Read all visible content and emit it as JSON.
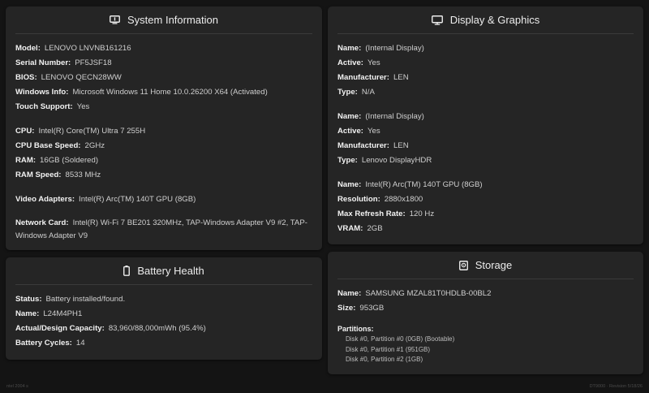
{
  "system": {
    "title": "System Information",
    "model_label": "Model:",
    "model": "LENOVO LNVNB161216",
    "serial_label": "Serial Number:",
    "serial": "PF5JSF18",
    "bios_label": "BIOS:",
    "bios": "LENOVO QECN28WW",
    "windows_label": "Windows Info:",
    "windows": "Microsoft Windows 11 Home 10.0.26200 X64 (Activated)",
    "touch_label": "Touch Support:",
    "touch": "Yes",
    "cpu_label": "CPU:",
    "cpu": "Intel(R) Core(TM) Ultra 7 255H",
    "cpu_speed_label": "CPU Base Speed:",
    "cpu_speed": "2GHz",
    "ram_label": "RAM:",
    "ram": "16GB (Soldered)",
    "ram_speed_label": "RAM Speed:",
    "ram_speed": "8533 MHz",
    "video_label": "Video Adapters:",
    "video": "Intel(R) Arc(TM) 140T GPU (8GB)",
    "network_label": "Network Card:",
    "network": "Intel(R) Wi-Fi 7 BE201 320MHz, TAP-Windows Adapter V9 #2, TAP-Windows Adapter V9"
  },
  "battery": {
    "title": "Battery Health",
    "status_label": "Status:",
    "status": "Battery installed/found.",
    "name_label": "Name:",
    "name": "L24M4PH1",
    "capacity_label": "Actual/Design Capacity:",
    "capacity": "83,960/88,000mWh (95.4%)",
    "cycles_label": "Battery Cycles:",
    "cycles": "14"
  },
  "display": {
    "title": "Display & Graphics",
    "d1": {
      "name_label": "Name:",
      "name": "(Internal Display)",
      "active_label": "Active:",
      "active": "Yes",
      "manufacturer_label": "Manufacturer:",
      "manufacturer": "LEN",
      "type_label": "Type:",
      "type": "N/A"
    },
    "d2": {
      "name_label": "Name:",
      "name": "(Internal Display)",
      "active_label": "Active:",
      "active": "Yes",
      "manufacturer_label": "Manufacturer:",
      "manufacturer": "LEN",
      "type_label": "Type:",
      "type": "Lenovo DisplayHDR"
    },
    "gpu": {
      "name_label": "Name:",
      "name": "Intel(R) Arc(TM) 140T GPU (8GB)",
      "resolution_label": "Resolution:",
      "resolution": "2880x1800",
      "refresh_label": "Max Refresh Rate:",
      "refresh": "120 Hz",
      "vram_label": "VRAM:",
      "vram": "2GB"
    }
  },
  "storage": {
    "title": "Storage",
    "name_label": "Name:",
    "name": "SAMSUNG MZAL81T0HDLB-00BL2",
    "size_label": "Size:",
    "size": "953GB",
    "partitions_label": "Partitions:",
    "partitions": [
      "Disk #0, Partition #0 (0GB) (Bootable)",
      "Disk #0, Partition #1 (951GB)",
      "Disk #0, Partition #2 (1GB)"
    ]
  },
  "footer": {
    "left": "ntel 2004 s",
    "right": "DT9000 · Revision 5/18/26"
  }
}
